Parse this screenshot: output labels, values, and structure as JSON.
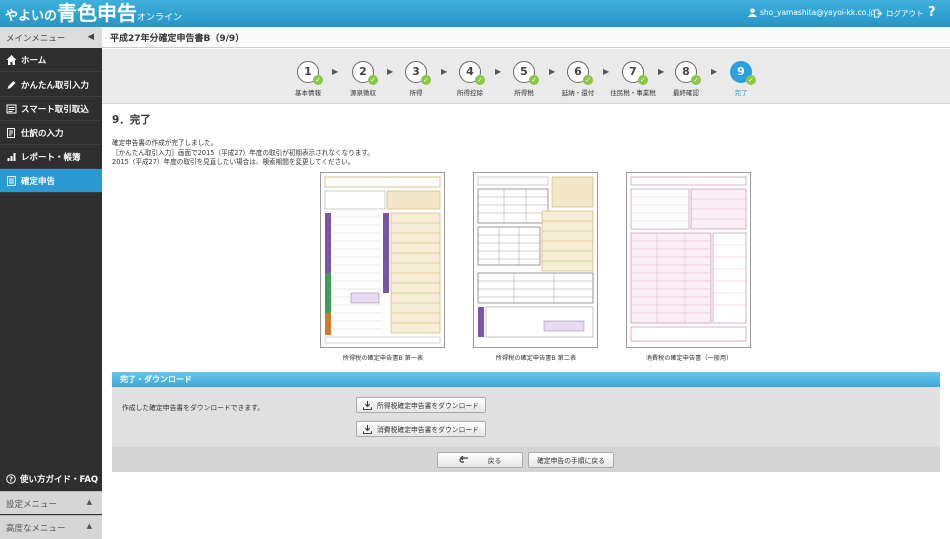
{
  "header": {
    "logo_prefix": "やよいの",
    "logo_main": "青色申告",
    "logo_suffix": "オンライン",
    "user_email": "sho_yamashita@yayoi-kk.co.jp",
    "logout_label": "ログアウト",
    "help_label": "?"
  },
  "sidebar": {
    "main_menu_label": "メインメニュー",
    "items": [
      {
        "label": "ホーム",
        "icon": "home-icon"
      },
      {
        "label": "かんたん取引入力",
        "icon": "pencil-icon"
      },
      {
        "label": "スマート取引取込",
        "icon": "import-icon"
      },
      {
        "label": "仕訳の入力",
        "icon": "journal-icon"
      },
      {
        "label": "レポート・帳簿",
        "icon": "chart-icon"
      },
      {
        "label": "確定申告",
        "icon": "document-icon",
        "active": true
      }
    ],
    "guide_label": "使い方ガイド・FAQ",
    "settings_menu_label": "設定メニュー",
    "advanced_menu_label": "高度なメニュー"
  },
  "page": {
    "title": "平成27年分確定申告書B（9/9）"
  },
  "steps": [
    {
      "number": "1",
      "label": "基本情報",
      "done": true
    },
    {
      "number": "2",
      "label": "源泉徴収",
      "done": true
    },
    {
      "number": "3",
      "label": "所得",
      "done": true
    },
    {
      "number": "4",
      "label": "所得控除",
      "done": true
    },
    {
      "number": "5",
      "label": "所得税",
      "done": true
    },
    {
      "number": "6",
      "label": "延納・還付",
      "done": true
    },
    {
      "number": "7",
      "label": "住民税・事業税",
      "done": true
    },
    {
      "number": "8",
      "label": "最終確認",
      "done": true
    },
    {
      "number": "9",
      "label": "完了",
      "current": true
    }
  ],
  "content": {
    "heading": "9．完了",
    "message_lines": [
      "確定申告書の作成が完了しました。",
      "［かんたん取引入力］画面で2015（平成27）年度の取引が初期表示されなくなります。",
      "2015（平成27）年度の取引を見直したい場合は、検索期間を変更してください。"
    ],
    "forms": [
      {
        "caption": "所得税の確定申告書B 第一表"
      },
      {
        "caption": "所得税の確定申告書B 第二表"
      },
      {
        "caption": "消費税の確定申告書（一般用）"
      }
    ]
  },
  "download": {
    "panel_title": "完了・ダウンロード",
    "message": "作成した確定申告書をダウンロードできます。",
    "income_tax_button": "所得税確定申告書をダウンロード",
    "consumption_tax_button": "消費税確定申告書をダウンロード",
    "back_button": "戻る",
    "return_button": "確定申告の手順に戻る"
  },
  "colors": {
    "brand": "#2596c6",
    "active_nav": "#2a9ad2",
    "check_green": "#8cc63f",
    "sidebar_bg": "#2e2e2e"
  }
}
